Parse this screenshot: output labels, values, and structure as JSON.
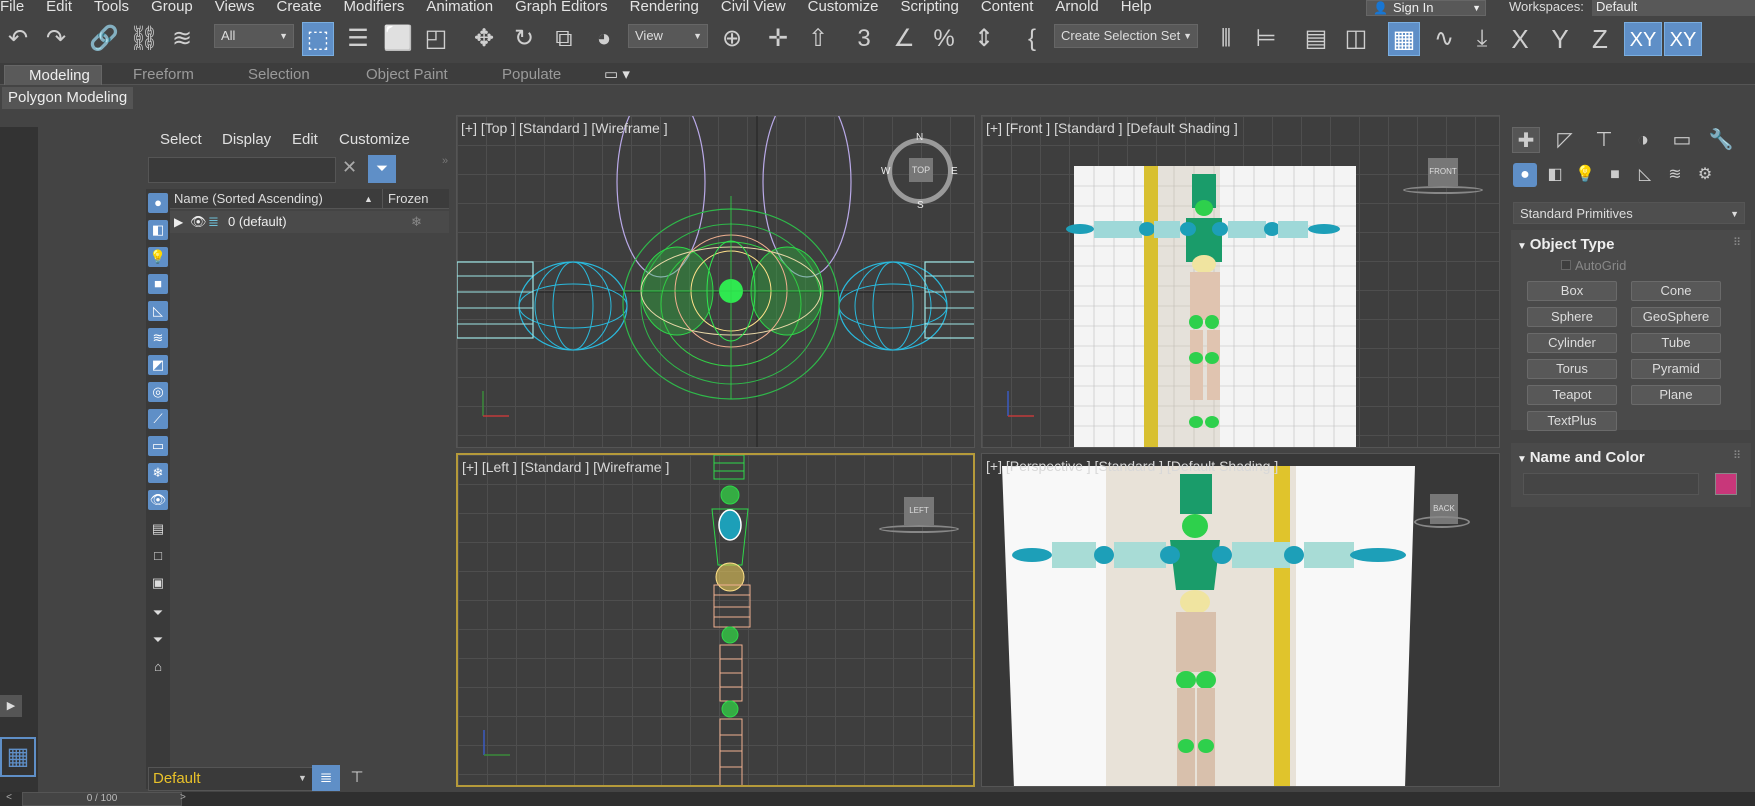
{
  "menu": [
    "File",
    "Edit",
    "Tools",
    "Group",
    "Views",
    "Create",
    "Modifiers",
    "Animation",
    "Graph Editors",
    "Rendering",
    "Civil View",
    "Customize",
    "Scripting",
    "Content",
    "Arnold",
    "Help"
  ],
  "signin": {
    "label": "Sign In"
  },
  "workspaces": {
    "label": "Workspaces:",
    "value": "Default"
  },
  "toolbar": {
    "filter_value": "All",
    "refcoord_value": "View",
    "selection_set_value": "Create Selection Set",
    "axis_x": "X",
    "axis_y": "Y",
    "axis_z": "Z",
    "axis_xy": "XY",
    "axis_xy2": "XY"
  },
  "ribbon": {
    "tabs": [
      "Modeling",
      "Freeform",
      "Selection",
      "Object Paint",
      "Populate"
    ],
    "panel_label": "Polygon Modeling"
  },
  "scene_explorer": {
    "tabs": [
      "Select",
      "Display",
      "Edit",
      "Customize"
    ],
    "col_name": "Name (Sorted Ascending)",
    "col_frozen": "Frozen",
    "row_label": "0 (default)",
    "layer_value": "Default"
  },
  "viewports": {
    "top": "[+] [Top ] [Standard ] [Wireframe ]",
    "front": "[+] [Front ] [Standard ] [Default Shading ]",
    "left": "[+] [Left ] [Standard ] [Wireframe ]",
    "persp": "[+] [Perspective ] [Standard ] [Default Shading ]",
    "viewcube_top": "TOP",
    "viewcube_front": "FRONT",
    "viewcube_left": "LEFT",
    "viewcube_back": "BACK",
    "compass_n": "N",
    "compass_s": "S",
    "compass_e": "E",
    "compass_w": "W"
  },
  "command_panel": {
    "category": "Standard Primitives",
    "object_type_title": "Object Type",
    "autogrid": "AutoGrid",
    "buttons": [
      "Box",
      "Cone",
      "Sphere",
      "GeoSphere",
      "Cylinder",
      "Tube",
      "Torus",
      "Pyramid",
      "Teapot",
      "Plane",
      "TextPlus"
    ],
    "name_color_title": "Name and Color",
    "swatch_color": "#c8377a"
  },
  "timeline": {
    "frame": "0 / 100"
  },
  "colors": {
    "accent": "#5f8fc7",
    "active_viewport": "#b59a3a"
  }
}
